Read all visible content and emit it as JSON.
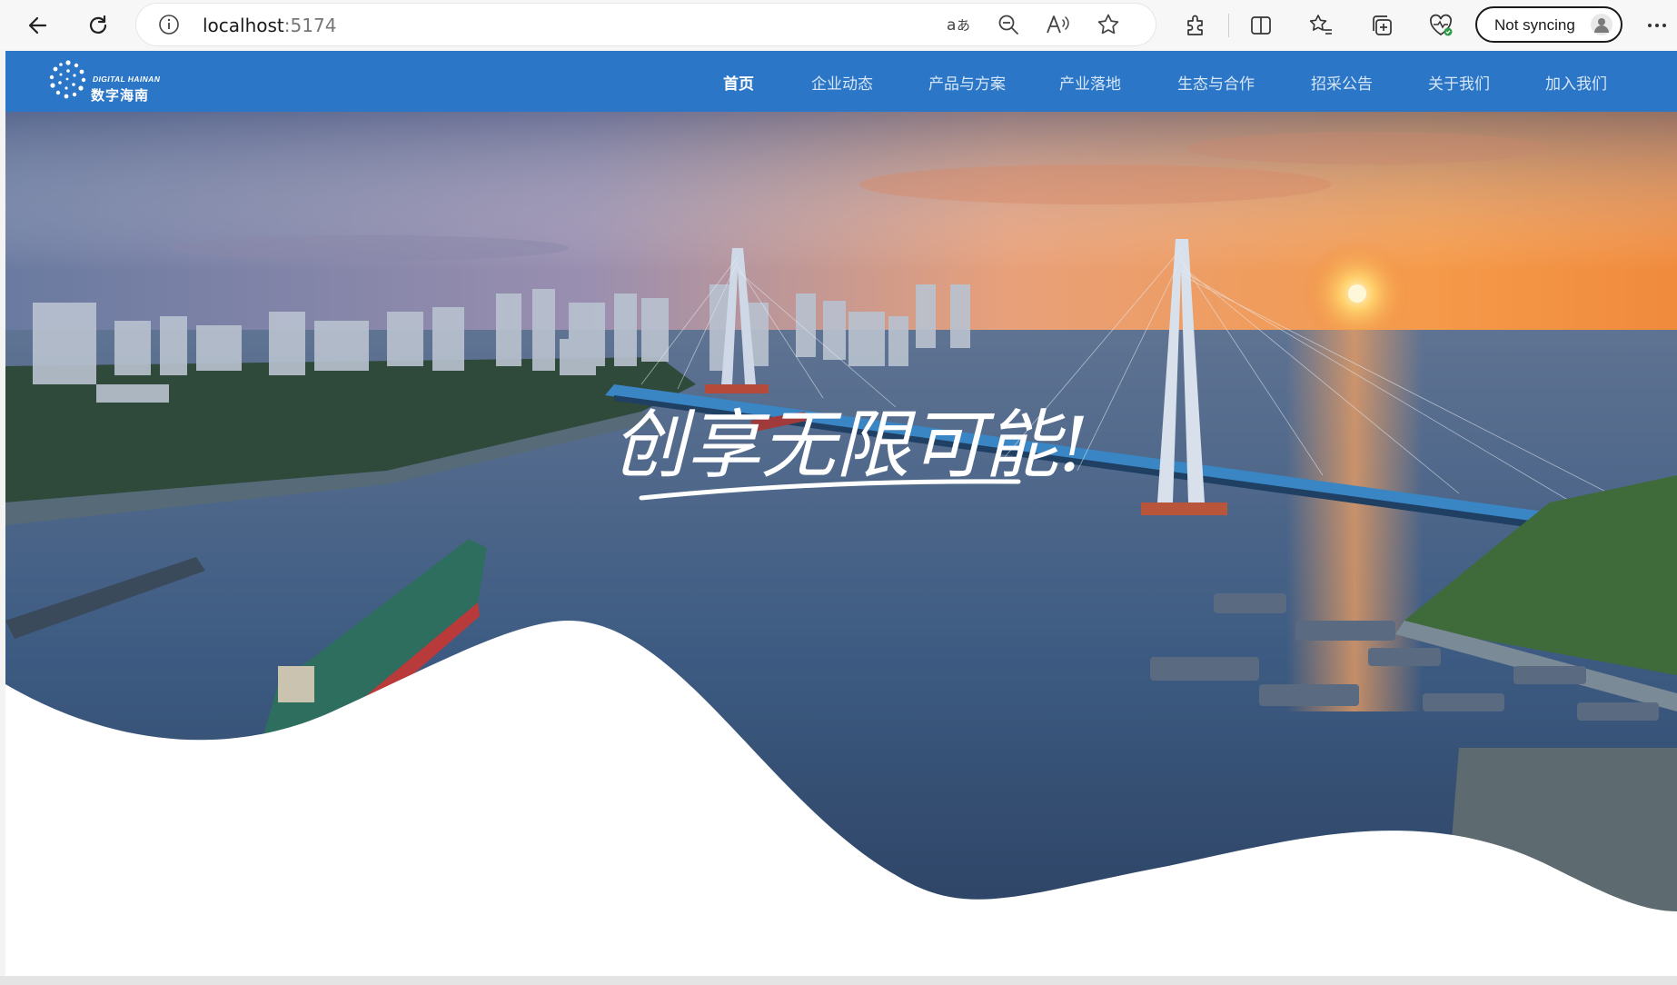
{
  "browser": {
    "url_host": "localhost",
    "url_port": ":5174",
    "sync_label": "Not syncing"
  },
  "site": {
    "logo_en": "DIGITAL HAINAN",
    "logo_cn": "数字海南",
    "nav": [
      {
        "label": "首页",
        "active": true
      },
      {
        "label": "企业动态",
        "active": false
      },
      {
        "label": "产品与方案",
        "active": false
      },
      {
        "label": "产业落地",
        "active": false
      },
      {
        "label": "生态与合作",
        "active": false
      },
      {
        "label": "招采公告",
        "active": false
      },
      {
        "label": "关于我们",
        "active": false
      },
      {
        "label": "加入我们",
        "active": false
      }
    ]
  },
  "hero": {
    "slogan": "创享无限可能!"
  },
  "colors": {
    "header_blue": "#2b76c6",
    "sky_top": "#5d6f95",
    "sunset_orange": "#f08a3c",
    "water_blue": "#3d5b82"
  }
}
